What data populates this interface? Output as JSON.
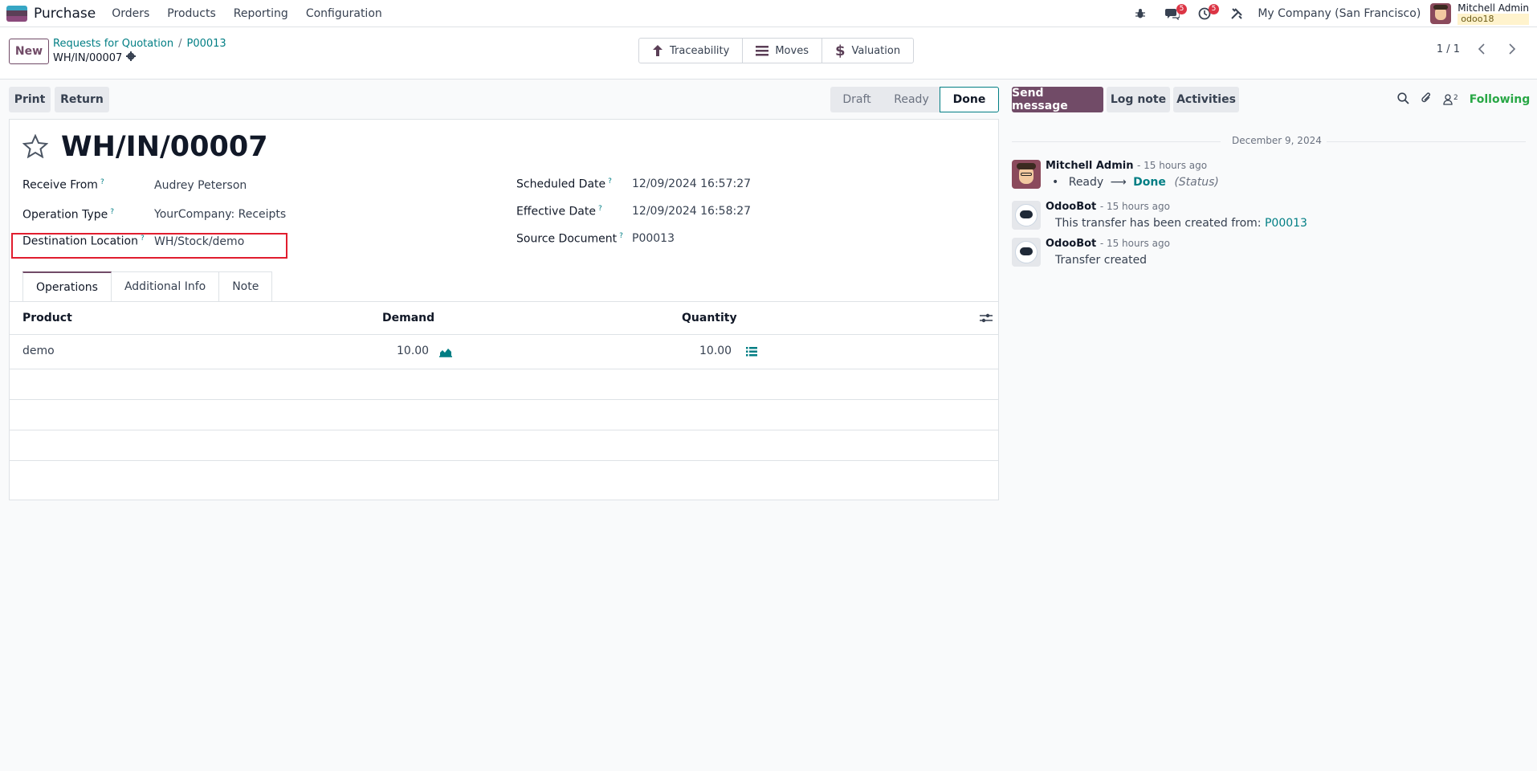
{
  "navbar": {
    "app_name": "Purchase",
    "menu": [
      "Orders",
      "Products",
      "Reporting",
      "Configuration"
    ],
    "messages_badge": "5",
    "activities_badge": "5",
    "company": "My Company (San Francisco)",
    "user_name": "Mitchell Admin",
    "database": "odoo18"
  },
  "control": {
    "new_label": "New",
    "breadcrumb": [
      "Requests for Quotation",
      "P00013"
    ],
    "record_name": "WH/IN/00007",
    "smart_buttons": [
      "Traceability",
      "Moves",
      "Valuation"
    ],
    "pager": "1 / 1"
  },
  "actions": {
    "print": "Print",
    "return": "Return",
    "statuses": [
      "Draft",
      "Ready",
      "Done"
    ],
    "active_status": "Done"
  },
  "form": {
    "title": "WH/IN/00007",
    "fields_left": [
      {
        "label": "Receive From",
        "value": "Audrey Peterson"
      },
      {
        "label": "Operation Type",
        "value": "YourCompany: Receipts"
      },
      {
        "label": "Destination Location",
        "value": "WH/Stock/demo"
      }
    ],
    "fields_right": [
      {
        "label": "Scheduled Date",
        "value": "12/09/2024 16:57:27"
      },
      {
        "label": "Effective Date",
        "value": "12/09/2024 16:58:27"
      },
      {
        "label": "Source Document",
        "value": "P00013"
      }
    ],
    "tabs": [
      "Operations",
      "Additional Info",
      "Note"
    ],
    "table": {
      "columns": [
        "Product",
        "Demand",
        "Quantity"
      ],
      "rows": [
        {
          "product": "demo",
          "demand": "10.00",
          "quantity": "10.00"
        }
      ]
    }
  },
  "chatter": {
    "send_message": "Send message",
    "log_note": "Log note",
    "activities": "Activities",
    "followers_count": "2",
    "following": "Following",
    "date": "December 9, 2024",
    "messages": [
      {
        "author": "Mitchell Admin",
        "time": "- 15 hours ago",
        "from": "Ready",
        "to": "Done",
        "field": "(Status)"
      },
      {
        "author": "OdooBot",
        "time": "- 15 hours ago",
        "text": "This transfer has been created from:",
        "link": "P00013"
      },
      {
        "author": "OdooBot",
        "time": "- 15 hours ago",
        "text": "Transfer created"
      }
    ]
  },
  "colors": {
    "brand": "#714b67",
    "link": "#017e84",
    "highlight": "#e11d2e",
    "following": "#28a745"
  }
}
